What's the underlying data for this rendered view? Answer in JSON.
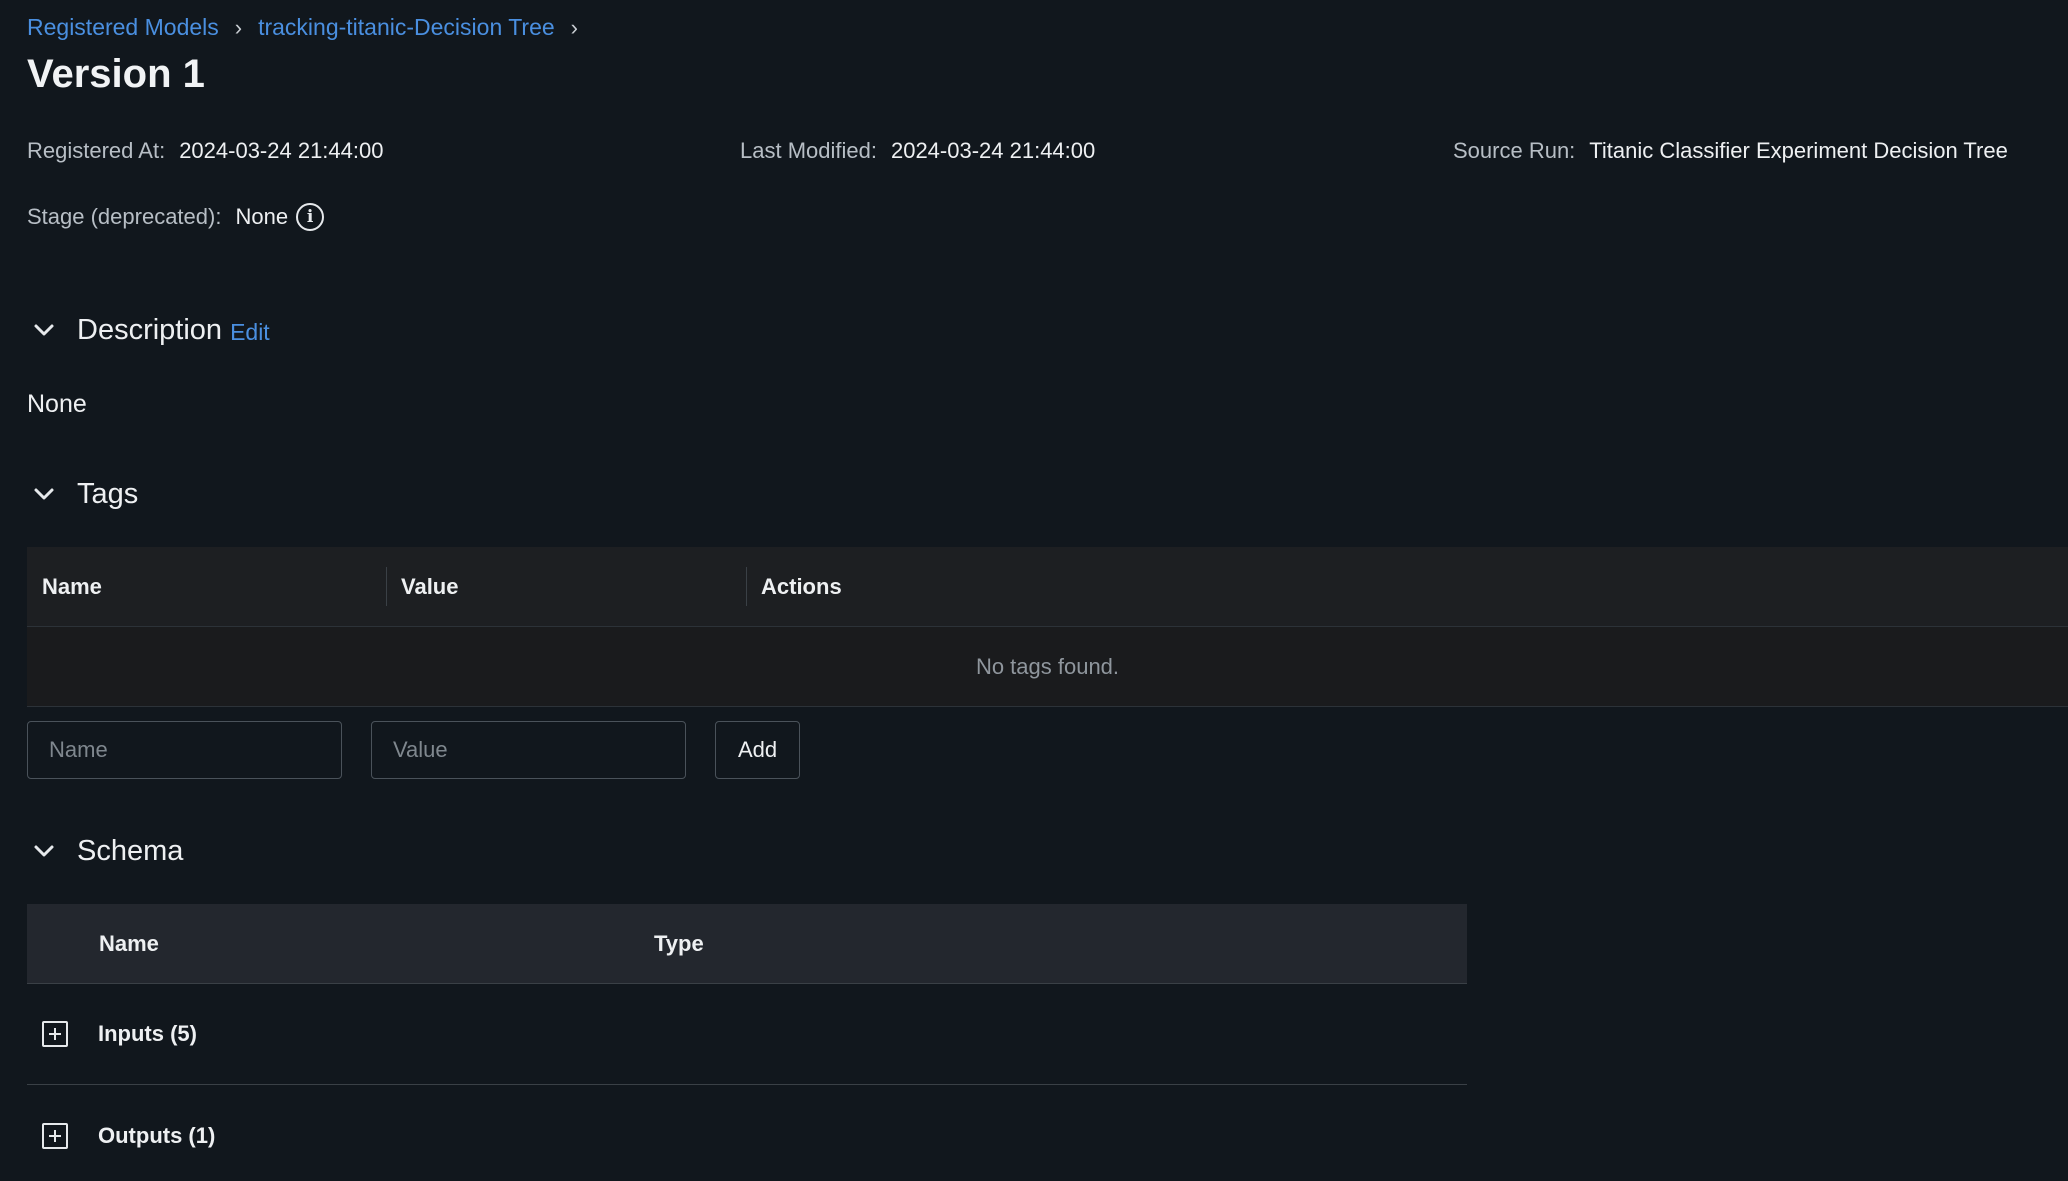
{
  "breadcrumb": {
    "items": [
      "Registered Models",
      "tracking-titanic-Decision Tree"
    ],
    "separator": "›"
  },
  "page_title": "Version 1",
  "meta": {
    "registered_at_label": "Registered At:",
    "registered_at_value": "2024-03-24 21:44:00",
    "last_modified_label": "Last Modified:",
    "last_modified_value": "2024-03-24 21:44:00",
    "source_run_label": "Source Run:",
    "source_run_value": "Titanic Classifier Experiment Decision Tree",
    "stage_label": "Stage (deprecated):",
    "stage_value": "None"
  },
  "icons": {
    "chevron": "chevron-down-icon",
    "info": "info-icon",
    "expand": "plus-square-icon"
  },
  "description": {
    "title": "Description",
    "edit_label": "Edit",
    "value": "None"
  },
  "tags": {
    "title": "Tags",
    "columns": [
      "Name",
      "Value",
      "Actions"
    ],
    "empty_text": "No tags found.",
    "name_placeholder": "Name",
    "value_placeholder": "Value",
    "add_label": "Add"
  },
  "schema": {
    "title": "Schema",
    "columns": [
      "Name",
      "Type"
    ],
    "rows": [
      "Inputs (5)",
      "Outputs (1)"
    ]
  },
  "colors": {
    "background": "#11171d",
    "link": "#4a8fe0",
    "table_header": "#1d1f22",
    "schema_header": "#23272e"
  }
}
